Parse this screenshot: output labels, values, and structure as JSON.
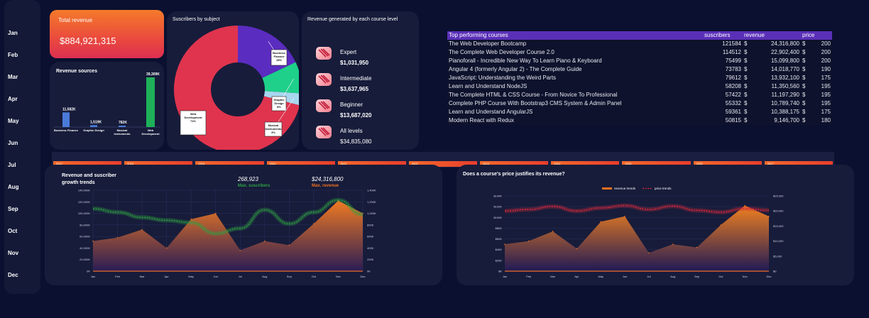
{
  "months": [
    "Jan",
    "Feb",
    "Mar",
    "Apr",
    "May",
    "Jun",
    "Jul",
    "Aug",
    "Sep",
    "Oct",
    "Nov",
    "Dec"
  ],
  "kpi": {
    "label": "Total revenue",
    "value": "$884,921,315"
  },
  "revenue_sources": {
    "title": "Revenue sources",
    "bars": [
      {
        "label": "Business Finance",
        "value_label": "11,582K",
        "value": 11582,
        "color": "#4a7bd8"
      },
      {
        "label": "Graphic Design",
        "value_label": "1,519K",
        "value": 1519,
        "color": "#4a7bd8"
      },
      {
        "label": "Musical Instruments",
        "value_label": "782K",
        "value": 782,
        "color": "#4a7bd8"
      },
      {
        "label": "Web Development",
        "value_label": "39,309K",
        "value": 39309,
        "color": "#1fb15a"
      }
    ]
  },
  "subscribers": {
    "title": "Suscribers by subject",
    "slices": [
      {
        "name": "Business Finance",
        "pct": 18,
        "color": "#5b2cc0",
        "callout": "Business Finance 18%"
      },
      {
        "name": "Graphic Design",
        "pct": 8,
        "color": "#1ed08a",
        "callout": "Graphic Design 8%"
      },
      {
        "name": "Musical Instruments",
        "pct": 3,
        "color": "#a8d6ef",
        "callout": "Musical Instruments 3%"
      },
      {
        "name": "Web Development",
        "pct": 71,
        "color": "#e0344e",
        "callout": "Web Development 71%"
      }
    ]
  },
  "levels": {
    "title": "Revenue generated by each course level",
    "items": [
      {
        "name": "Expert",
        "value": "$1,031,950"
      },
      {
        "name": "Intermediate",
        "value": "$3,637,965"
      },
      {
        "name": "Beginner",
        "value": "$13,687,020"
      },
      {
        "name": "All levels",
        "value": "$34,835,080"
      }
    ]
  },
  "top_courses": {
    "headers": [
      "Top performing courses",
      "suscribers",
      "revenue",
      "price"
    ],
    "rows": [
      [
        "The Web Developer Bootcamp",
        "121584",
        "$",
        "24,316,800",
        "$",
        "200"
      ],
      [
        "The Complete Web Developer Course 2.0",
        "114512",
        "$",
        "22,902,400",
        "$",
        "200"
      ],
      [
        "Pianoforall - Incredible New Way To Learn Piano & Keyboard",
        "75499",
        "$",
        "15,099,800",
        "$",
        "200"
      ],
      [
        "Angular 4 (formerly Angular 2) - The Complete Guide",
        "73783",
        "$",
        "14,018,770",
        "$",
        "190"
      ],
      [
        "JavaScript: Understanding the Weird Parts",
        "79612",
        "$",
        "13,932,100",
        "$",
        "175"
      ],
      [
        "Learn and Understand NodeJS",
        "58208",
        "$",
        "11,350,560",
        "$",
        "195"
      ],
      [
        "The Complete HTML & CSS Course - From Novice To Professional",
        "57422",
        "$",
        "11,197,290",
        "$",
        "195"
      ],
      [
        "Complete PHP Course With Bootstrap3 CMS System & Admin Panel",
        "55332",
        "$",
        "10,789,740",
        "$",
        "195"
      ],
      [
        "Learn and Understand AngularJS",
        "59361",
        "$",
        "10,388,175",
        "$",
        "175"
      ],
      [
        "Modern React with Redux",
        "50815",
        "$",
        "9,146,700",
        "$",
        "180"
      ]
    ]
  },
  "timeline": {
    "years": [
      "2017",
      "2018",
      "2019",
      "2020",
      "2021",
      "2022",
      "2023",
      "2024",
      "2025",
      "2026",
      "2027"
    ]
  },
  "chart_data": [
    {
      "type": "area",
      "title": "Revenue and suscriber growth trends",
      "annotations": [
        {
          "value": "268,923",
          "label": "Max. suscribers",
          "color": "#2ea043"
        },
        {
          "value": "$24,316,800",
          "label": "Max. revenue",
          "color": "#f07020"
        }
      ],
      "categories": [
        "Jan",
        "Feb",
        "Mar",
        "Apr",
        "May",
        "Jun",
        "Jul",
        "Aug",
        "Sep",
        "Oct",
        "Nov",
        "Dec"
      ],
      "left_axis": {
        "ticks": [
          "0K",
          "20,000K",
          "40,000K",
          "60,000K",
          "80,000K",
          "100,000K",
          "120,000K",
          "140,000K"
        ],
        "range": [
          0,
          140000
        ]
      },
      "right_axis": {
        "ticks": [
          "0K",
          "200K",
          "400K",
          "600K",
          "800K",
          "1,000K",
          "1,200K",
          "1,400K"
        ],
        "range": [
          0,
          1400
        ]
      },
      "series": [
        {
          "name": "revenue",
          "axis": "left",
          "color": "#f07020",
          "values": [
            52000,
            58000,
            72000,
            40000,
            90000,
            100000,
            36000,
            52000,
            45000,
            82000,
            122000,
            100000
          ]
        },
        {
          "name": "suscribers",
          "axis": "right",
          "color": "#2ea043",
          "values": [
            1080,
            1020,
            930,
            880,
            840,
            650,
            740,
            1060,
            820,
            1020,
            1230,
            980
          ]
        }
      ]
    },
    {
      "type": "area",
      "title": "Does a course's price justifies its revenue?",
      "legend": [
        "revenue trends",
        "price trends"
      ],
      "categories": [
        "Jan",
        "Feb",
        "Mar",
        "Apr",
        "May",
        "Jun",
        "Jul",
        "Aug",
        "Sep",
        "Oct",
        "Nov",
        "Dec"
      ],
      "left_axis": {
        "ticks": [
          "$K",
          "$20K",
          "$40K",
          "$60K",
          "$80K",
          "$100K",
          "$120K",
          "$140K"
        ],
        "range": [
          0,
          140
        ]
      },
      "right_axis": {
        "ticks": [
          "$0",
          "$5,000",
          "$10,000",
          "$15,000",
          "$20,000",
          "$25,000"
        ],
        "range": [
          0,
          25000
        ]
      },
      "series": [
        {
          "name": "revenue trends",
          "axis": "left",
          "color": "#f07020",
          "values": [
            50,
            56,
            74,
            42,
            92,
            102,
            34,
            50,
            44,
            86,
            122,
            102
          ]
        },
        {
          "name": "price trends",
          "axis": "right",
          "color": "#e0283c",
          "values": [
            20000,
            20500,
            21500,
            20000,
            21000,
            21800,
            20500,
            21600,
            20200,
            19600,
            20800,
            20200
          ]
        }
      ]
    }
  ]
}
